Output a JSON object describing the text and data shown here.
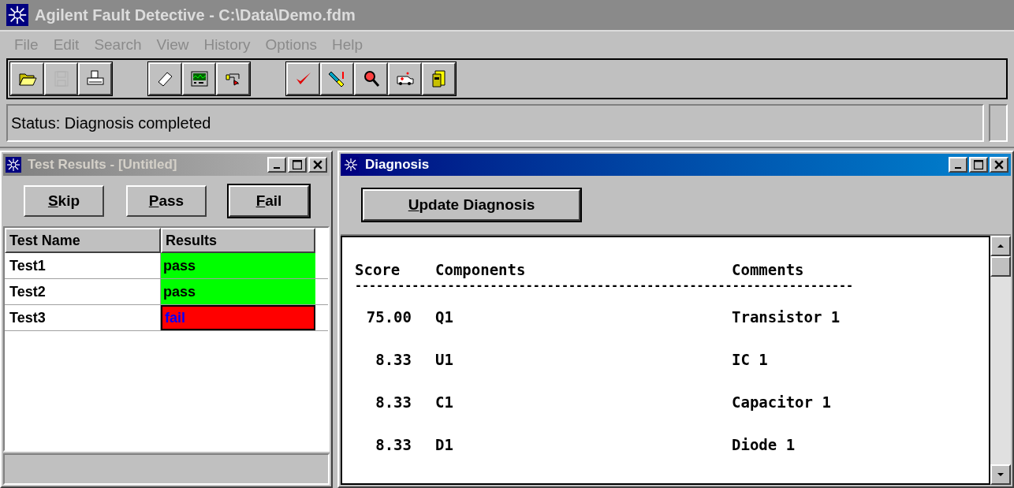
{
  "window": {
    "title": "Agilent Fault Detective - C:\\Data\\Demo.fdm",
    "active": false
  },
  "menu": [
    {
      "label": "File",
      "disabled": true
    },
    {
      "label": "Edit",
      "disabled": true
    },
    {
      "label": "Search",
      "disabled": true
    },
    {
      "label": "View",
      "disabled": true
    },
    {
      "label": "History",
      "disabled": true
    },
    {
      "label": "Options",
      "disabled": true
    },
    {
      "label": "Help",
      "disabled": true
    }
  ],
  "toolbar": [
    [
      {
        "kind": "folder",
        "disabled": false
      },
      {
        "kind": "disk",
        "disabled": true
      },
      {
        "kind": "printer",
        "disabled": false
      }
    ],
    [
      {
        "kind": "ruler",
        "disabled": false
      },
      {
        "kind": "scope",
        "disabled": false
      },
      {
        "kind": "plug",
        "disabled": false
      }
    ],
    [
      {
        "kind": "check",
        "disabled": false
      },
      {
        "kind": "probe",
        "disabled": false
      },
      {
        "kind": "magnifier",
        "disabled": false
      },
      {
        "kind": "ambulance",
        "disabled": false
      },
      {
        "kind": "cabinet",
        "disabled": false
      }
    ]
  ],
  "status_bar": {
    "text": "Status: Diagnosis completed"
  },
  "test_results": {
    "title": "Test Results - [Untitled]",
    "active": false,
    "buttons": [
      {
        "label": "Skip",
        "default": false
      },
      {
        "label": "Pass",
        "default": false
      },
      {
        "label": "Fail",
        "default": true
      }
    ],
    "columns": [
      "Test Name",
      "Results"
    ],
    "rows": [
      {
        "name": "Test1",
        "result": "pass",
        "kind": "pass"
      },
      {
        "name": "Test2",
        "result": "pass",
        "kind": "pass"
      },
      {
        "name": "Test3",
        "result": "fail",
        "kind": "fail"
      }
    ]
  },
  "diagnosis": {
    "title": "Diagnosis",
    "active": true,
    "button": "Update Diagnosis",
    "columns": [
      "Score",
      "Components",
      "Comments"
    ],
    "separator": "----------------------------------------------------------------------",
    "rows": [
      {
        "score": "75.00",
        "component": "Q1",
        "comment": "Transistor 1"
      },
      {
        "score": "8.33",
        "component": "U1",
        "comment": "IC 1"
      },
      {
        "score": "8.33",
        "component": "C1",
        "comment": "Capacitor 1"
      },
      {
        "score": "8.33",
        "component": "D1",
        "comment": "Diode 1"
      }
    ]
  }
}
